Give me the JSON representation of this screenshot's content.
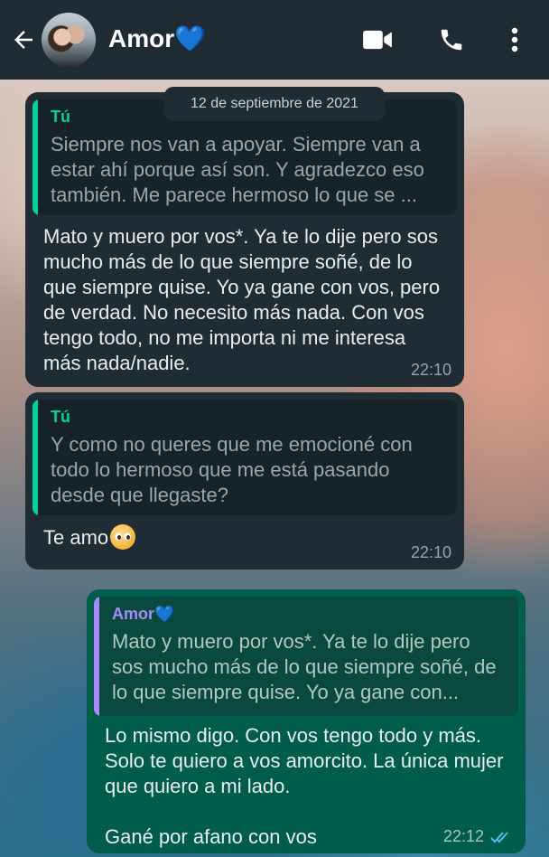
{
  "header": {
    "contact_name": "Amor💙",
    "icons": {
      "back": "arrow-left-icon",
      "video": "video-camera-icon",
      "call": "phone-icon",
      "menu": "kebab-menu-icon"
    }
  },
  "chat": {
    "date_label": "12 de septiembre de 2021",
    "messages": [
      {
        "direction": "incoming",
        "quote": {
          "author": "Tú",
          "text": "Siempre nos van a apoyar. Siempre van a estar ahí porque así son. Y agradezco eso también. Me parece hermoso lo que se ..."
        },
        "text": "Mato y muero por vos*. Ya te lo dije pero sos mucho más de lo que siempre soñé, de lo que siempre quise. Yo ya gane con vos, pero de verdad. No necesito más nada. Con vos tengo todo, no me importa ni me interesa más nada/nadie.",
        "time": "22:10"
      },
      {
        "direction": "incoming",
        "quote": {
          "author": "Tú",
          "text": "Y como no queres que me emocioné con todo lo hermoso que me está pasando desde que llegaste?"
        },
        "text": "Te amo",
        "emoji": "pleading-face-emoji",
        "time": "22:10"
      },
      {
        "direction": "outgoing",
        "quote": {
          "author": "Amor💙",
          "text": "Mato y muero por vos*. Ya te lo dije pero sos mucho más de lo que siempre soñé, de lo que siempre quise. Yo ya gane con..."
        },
        "text_line1": "Lo mismo digo. Con vos tengo todo y más. Solo te quiero a vos amorcito. La única mujer que quiero a mi lado.",
        "text_line2": "Gané por afano con vos",
        "time": "22:12",
        "status": "read-double-check-icon"
      }
    ]
  },
  "colors": {
    "header_bg": "#1f2c34",
    "incoming_bubble": "#1f2c34",
    "outgoing_bubble": "#005c4b",
    "quote_self_accent": "#06cf9c",
    "quote_contact_accent": "#a78bfa",
    "read_tick": "#53bdeb"
  }
}
